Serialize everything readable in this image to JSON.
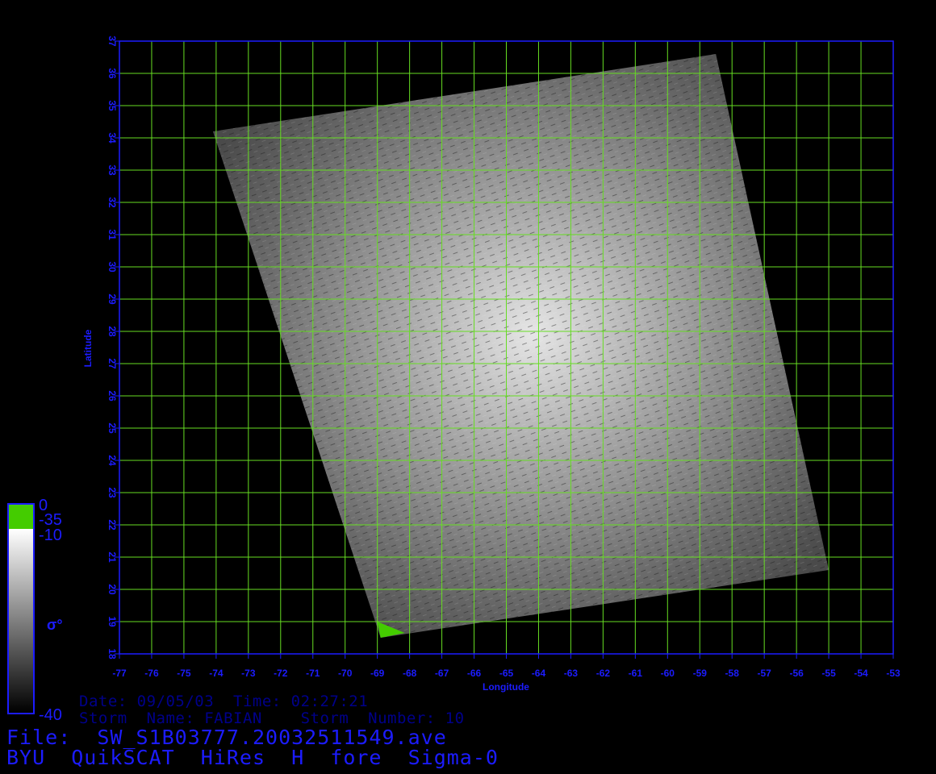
{
  "map": {
    "lon_range": [
      -77,
      -53
    ],
    "lat_range": [
      18,
      37
    ],
    "lon_ticks": [
      -77,
      -76,
      -75,
      -74,
      -73,
      -72,
      -71,
      -70,
      -69,
      -68,
      -67,
      -66,
      -65,
      -64,
      -63,
      -62,
      -61,
      -60,
      -59,
      -58,
      -57,
      -56,
      -55,
      -54,
      -53
    ],
    "lat_ticks": [
      18,
      19,
      20,
      21,
      22,
      23,
      24,
      25,
      26,
      27,
      28,
      29,
      30,
      31,
      32,
      33,
      34,
      35,
      36,
      37
    ],
    "xlabel": "Longitude",
    "ylabel": "Latitude",
    "grid": true,
    "colors": {
      "axis": "#1c1cff",
      "grid": "#66dd22",
      "background": "#000000",
      "high_value": "#44cc00"
    },
    "swath_corners_lonlat": [
      [
        -74.1,
        34.2
      ],
      [
        -58.5,
        36.6
      ],
      [
        -55.0,
        20.6
      ],
      [
        -68.9,
        18.5
      ]
    ]
  },
  "legend": {
    "max_label": "0",
    "cut_label": "-35",
    "upper_label": "-10",
    "min_label": "-40",
    "symbol": "σ°"
  },
  "info": {
    "date_line": "Date: 09/05/03  Time: 02:27:21",
    "storm_line": "Storm  Name: FABIAN    Storm  Number: 10",
    "file_line": "File:  SW_S1B03777.20032511549.ave",
    "product_line": "BYU  QuikSCAT  HiRes  H  fore  Sigma-0"
  }
}
